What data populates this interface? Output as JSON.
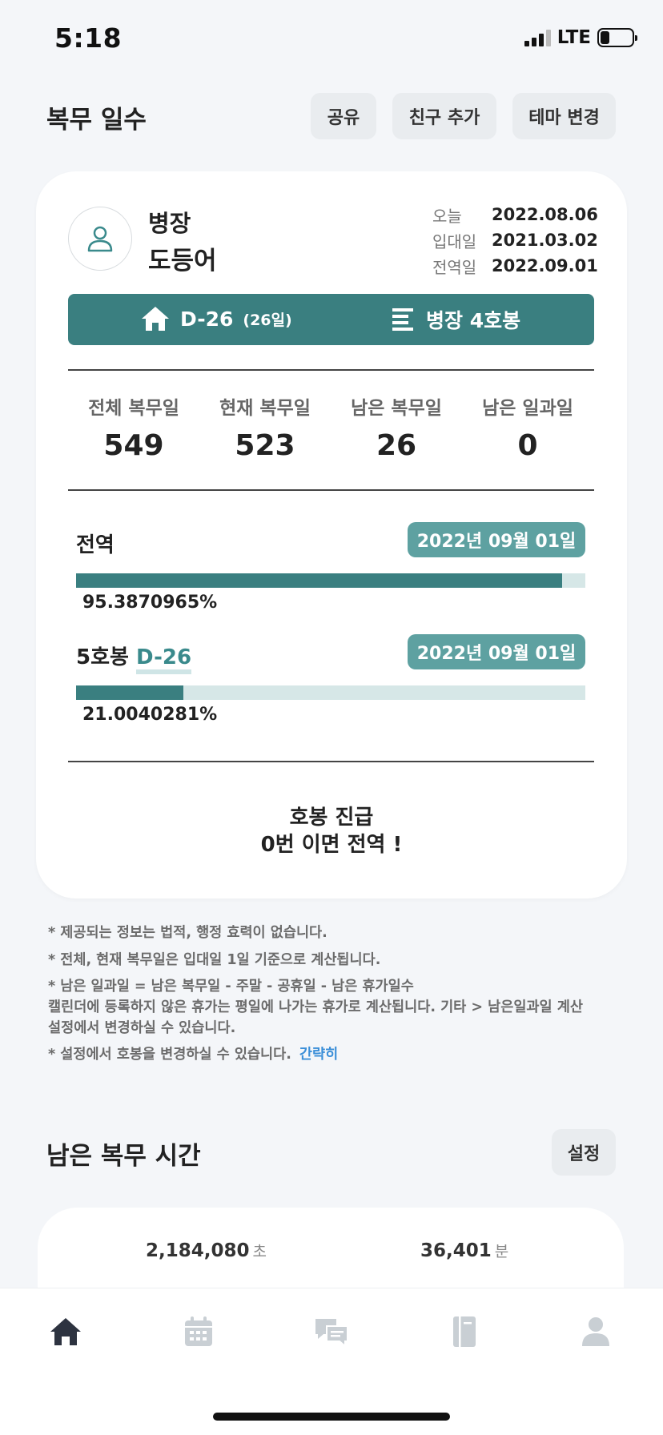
{
  "status": {
    "time": "5:18",
    "network": "LTE"
  },
  "header": {
    "title": "복무 일수",
    "share_label": "공유",
    "add_friend_label": "친구 추가",
    "theme_label": "테마 변경"
  },
  "profile": {
    "rank": "병장",
    "name": "도등어",
    "dates": [
      {
        "label": "오늘",
        "value": "2022.08.06"
      },
      {
        "label": "입대일",
        "value": "2021.03.02"
      },
      {
        "label": "전역일",
        "value": "2022.09.01"
      }
    ]
  },
  "banner": {
    "dday": "D-26",
    "dday_days": "(26일)",
    "rank_grade": "병장 4호봉",
    "accent_color": "#3a7f80"
  },
  "stats": [
    {
      "label": "전체 복무일",
      "value": "549"
    },
    {
      "label": "현재 복무일",
      "value": "523"
    },
    {
      "label": "남은 복무일",
      "value": "26"
    },
    {
      "label": "남은 일과일",
      "value": "0"
    }
  ],
  "progress": [
    {
      "label": "전역",
      "link": "",
      "date": "2022년 09월 01일",
      "percent_text": "95.3870965%",
      "fraction": 0.953870965
    },
    {
      "label": "5호봉",
      "link": "D-26",
      "date": "2022년 09월 01일",
      "percent_text": "21.0040281%",
      "fraction": 0.210040281
    }
  ],
  "promotion": {
    "line1": "호봉 진급",
    "line2": "0번 이면 전역 !"
  },
  "notes": {
    "n1": "* 제공되는 정보는 법적, 행정 효력이 없습니다.",
    "n2": "* 전체, 현재 복무일은 입대일 1일 기준으로 계산됩니다.",
    "n3a": "* 남은 일과일 = 남은 복무일 - 주말 - 공휴일 - 남은 휴가일수",
    "n3b": "캘린더에 등록하지 않은 휴가는 평일에 나가는 휴가로 계산됩니다. 기타 > 남은일과일 계산",
    "n3c": "설정에서 변경하실 수 있습니다.",
    "n4": "* 설정에서 호봉을 변경하실 수 있습니다.",
    "n4_link": "간략히"
  },
  "remaining_time": {
    "title": "남은 복무 시간",
    "settings_label": "설정",
    "seconds": "2,184,080",
    "seconds_unit": "초",
    "minutes": "36,401",
    "minutes_unit": "분"
  },
  "tabbar": {
    "tabs": [
      "home-icon",
      "calendar-icon",
      "chat-icon",
      "notebook-icon",
      "profile-icon"
    ],
    "active": "home-icon"
  }
}
